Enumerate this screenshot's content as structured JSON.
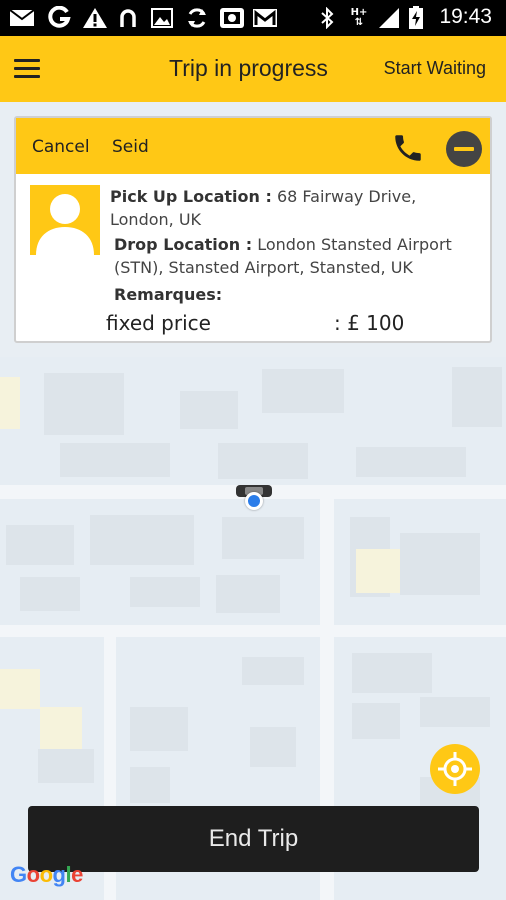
{
  "status_bar": {
    "time": "19:43",
    "icons": [
      "mail-icon",
      "g-icon",
      "warning-icon",
      "n-icon",
      "image-icon",
      "sync-icon",
      "screenshot-icon",
      "gmail-icon",
      "bluetooth-icon",
      "h-plus-icon",
      "signal-icon",
      "battery-icon"
    ]
  },
  "appbar": {
    "title": "Trip in progress",
    "action_label": "Start Waiting"
  },
  "card": {
    "cancel_label": "Cancel",
    "driver_name": "Seid",
    "pickup_label": "Pick Up Location :",
    "pickup_value": "68 Fairway Drive, London, UK",
    "drop_label": "Drop Location :",
    "drop_value": "London Stansted Airport (STN), Stansted Airport, Stansted, UK",
    "remarks_label": "Remarques:",
    "price_label": "fixed price",
    "price_value": ": £ 100"
  },
  "end_trip_label": "End Trip",
  "map_attribution": {
    "letters": [
      "G",
      "o",
      "o",
      "g",
      "l",
      "e"
    ],
    "colors": [
      "#4285f4",
      "#ea4335",
      "#fbbc05",
      "#4285f4",
      "#34a853",
      "#ea4335"
    ]
  },
  "colors": {
    "accent": "#ffc815",
    "end_trip_bg": "#1e1e1e",
    "location_dot": "#2b7de9"
  }
}
